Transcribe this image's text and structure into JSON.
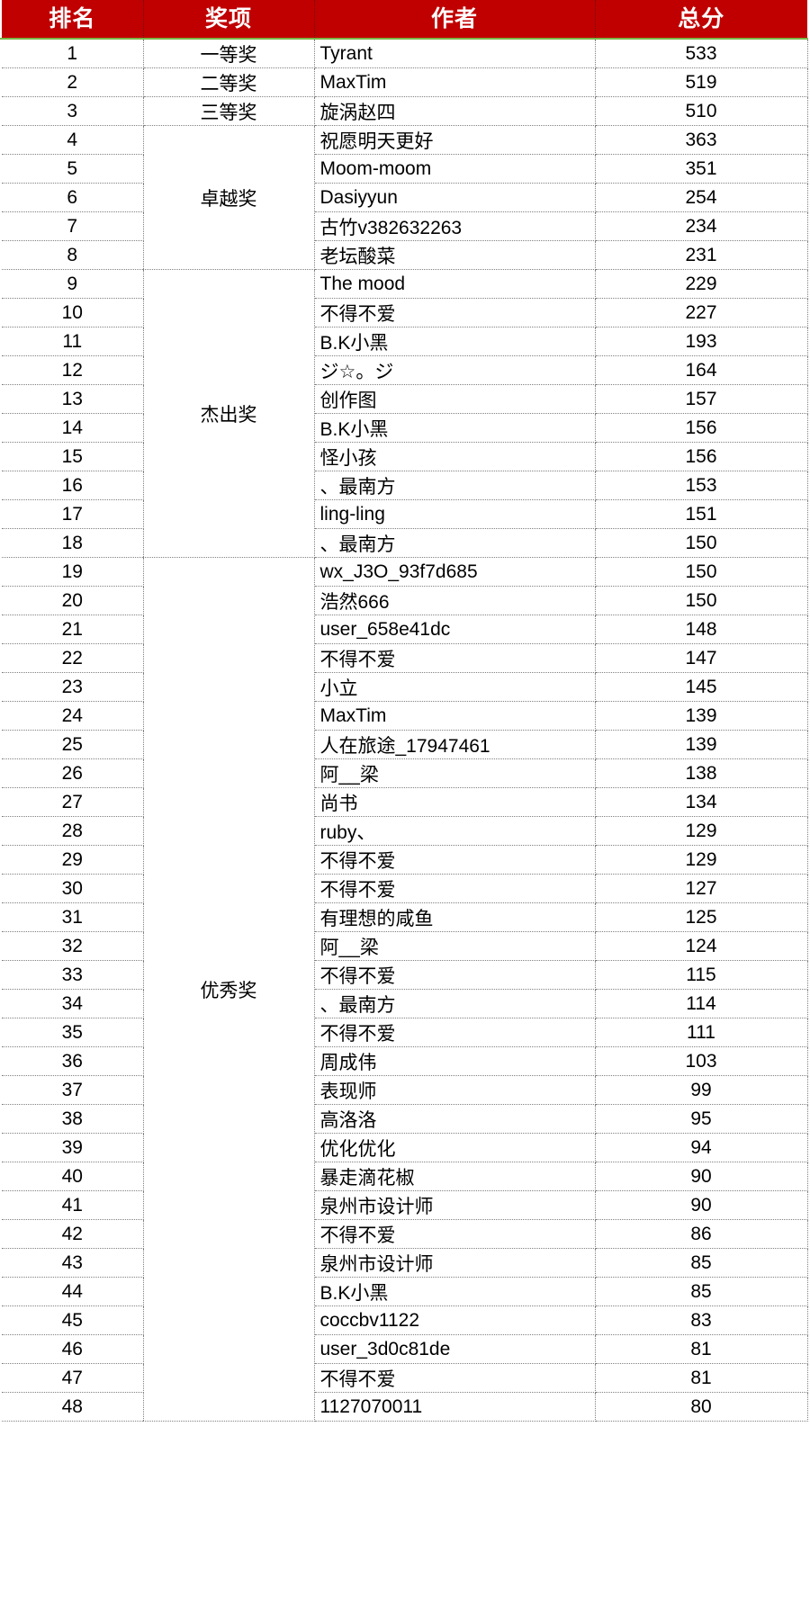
{
  "table": {
    "headers": [
      "排名",
      "奖项",
      "作者",
      "总分"
    ],
    "header_bg": "#C00000",
    "header_text_color": "#FFFFFF",
    "header_underline_color": "#7AB648",
    "grid_color": "#808080",
    "award_groups": [
      {
        "label": "一等奖",
        "rows": 1
      },
      {
        "label": "二等奖",
        "rows": 1
      },
      {
        "label": "三等奖",
        "rows": 1
      },
      {
        "label": "卓越奖",
        "rows": 5
      },
      {
        "label": "杰出奖",
        "rows": 10
      },
      {
        "label": "优秀奖",
        "rows": 30
      }
    ],
    "rows": [
      {
        "rank": "1",
        "author": "Tyrant",
        "score": "533"
      },
      {
        "rank": "2",
        "author": "MaxTim",
        "score": "519"
      },
      {
        "rank": "3",
        "author": "旋涡赵四",
        "score": "510"
      },
      {
        "rank": "4",
        "author": "祝愿明天更好",
        "score": "363"
      },
      {
        "rank": "5",
        "author": "Moom-moom",
        "score": "351"
      },
      {
        "rank": "6",
        "author": "Dasiyyun",
        "score": "254"
      },
      {
        "rank": "7",
        "author": "古竹v382632263",
        "score": "234"
      },
      {
        "rank": "8",
        "author": "老坛酸菜",
        "score": "231"
      },
      {
        "rank": "9",
        "author": "The mood",
        "score": "229"
      },
      {
        "rank": "10",
        "author": "不得不爱",
        "score": "227"
      },
      {
        "rank": "11",
        "author": "B.K小黑",
        "score": "193"
      },
      {
        "rank": "12",
        "author": "ジ☆。ジ",
        "score": "164"
      },
      {
        "rank": "13",
        "author": "创作图",
        "score": "157"
      },
      {
        "rank": "14",
        "author": "B.K小黑",
        "score": "156"
      },
      {
        "rank": "15",
        "author": "怪小孩",
        "score": "156"
      },
      {
        "rank": "16",
        "author": "、最南方",
        "score": "153"
      },
      {
        "rank": "17",
        "author": "ling-ling",
        "score": "151"
      },
      {
        "rank": "18",
        "author": "、最南方",
        "score": "150"
      },
      {
        "rank": "19",
        "author": "wx_J3O_93f7d685",
        "score": "150"
      },
      {
        "rank": "20",
        "author": "浩然666",
        "score": "150"
      },
      {
        "rank": "21",
        "author": "user_658e41dc",
        "score": "148"
      },
      {
        "rank": "22",
        "author": "不得不爱",
        "score": "147"
      },
      {
        "rank": "23",
        "author": "小立",
        "score": "145"
      },
      {
        "rank": "24",
        "author": "MaxTim",
        "score": "139"
      },
      {
        "rank": "25",
        "author": "人在旅途_17947461",
        "score": "139"
      },
      {
        "rank": "26",
        "author": "阿__梁",
        "score": "138"
      },
      {
        "rank": "27",
        "author": "尚书",
        "score": "134"
      },
      {
        "rank": "28",
        "author": "ruby、",
        "score": "129"
      },
      {
        "rank": "29",
        "author": "不得不爱",
        "score": "129"
      },
      {
        "rank": "30",
        "author": "不得不爱",
        "score": "127"
      },
      {
        "rank": "31",
        "author": "有理想的咸鱼",
        "score": "125"
      },
      {
        "rank": "32",
        "author": "阿__梁",
        "score": "124"
      },
      {
        "rank": "33",
        "author": "不得不爱",
        "score": "115"
      },
      {
        "rank": "34",
        "author": "、最南方",
        "score": "114"
      },
      {
        "rank": "35",
        "author": "不得不爱",
        "score": "111"
      },
      {
        "rank": "36",
        "author": "周成伟",
        "score": "103"
      },
      {
        "rank": "37",
        "author": "表现师",
        "score": "99"
      },
      {
        "rank": "38",
        "author": "高洛洛",
        "score": "95"
      },
      {
        "rank": "39",
        "author": "优化优化",
        "score": "94"
      },
      {
        "rank": "40",
        "author": "暴走滴花椒",
        "score": "90"
      },
      {
        "rank": "41",
        "author": "泉州市设计师",
        "score": "90"
      },
      {
        "rank": "42",
        "author": "不得不爱",
        "score": "86"
      },
      {
        "rank": "43",
        "author": "泉州市设计师",
        "score": "85"
      },
      {
        "rank": "44",
        "author": "B.K小黑",
        "score": "85"
      },
      {
        "rank": "45",
        "author": "coccbv1122",
        "score": "83"
      },
      {
        "rank": "46",
        "author": "user_3d0c81de",
        "score": "81"
      },
      {
        "rank": "47",
        "author": "不得不爱",
        "score": "81"
      },
      {
        "rank": "48",
        "author": "1127070011",
        "score": "80"
      }
    ]
  }
}
